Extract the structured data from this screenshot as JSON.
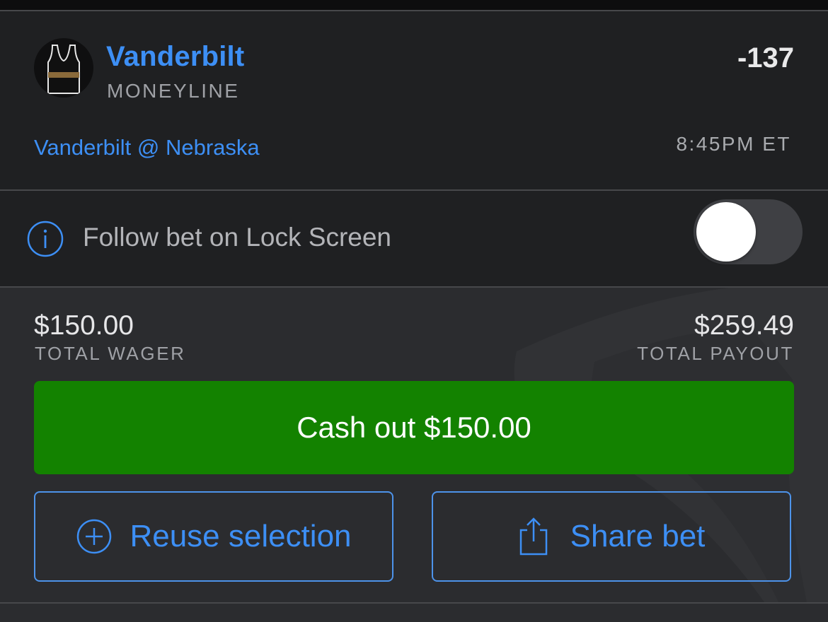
{
  "selection": {
    "team": "Vanderbilt",
    "market": "MONEYLINE",
    "odds": "-137",
    "matchup": "Vanderbilt @ Nebraska",
    "time": "8:45PM ET",
    "jersey_icon": "jersey-icon"
  },
  "follow": {
    "label": "Follow bet on Lock Screen",
    "icon": "info-icon",
    "enabled": false
  },
  "wager": {
    "amount": "$150.00",
    "label": "TOTAL WAGER"
  },
  "payout": {
    "amount": "$259.49",
    "label": "TOTAL PAYOUT"
  },
  "actions": {
    "cashout_label": "Cash out $150.00",
    "reuse_label": "Reuse selection",
    "reuse_icon": "plus-circle-icon",
    "share_label": "Share bet",
    "share_icon": "share-icon"
  },
  "colors": {
    "accent": "#3d8ff5",
    "cashout": "#138200",
    "background": "#2b2c2f",
    "card": "#1f2022"
  }
}
